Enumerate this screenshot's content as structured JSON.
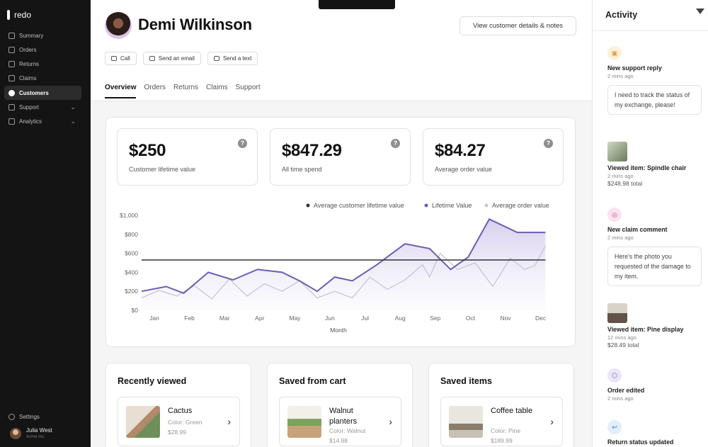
{
  "sidebar": {
    "logo": "redo",
    "nav": [
      {
        "label": "Summary",
        "active": false,
        "icon": "home-icon",
        "has_chevron": false
      },
      {
        "label": "Orders",
        "active": false,
        "icon": "box-icon",
        "has_chevron": false
      },
      {
        "label": "Returns",
        "active": false,
        "icon": "return-icon",
        "has_chevron": false
      },
      {
        "label": "Claims",
        "active": false,
        "icon": "alert-icon",
        "has_chevron": false
      },
      {
        "label": "Customers",
        "active": true,
        "icon": "customer-icon",
        "has_chevron": false
      },
      {
        "label": "Support",
        "active": false,
        "icon": "chat-icon",
        "has_chevron": true
      },
      {
        "label": "Analytics",
        "active": false,
        "icon": "chart-icon",
        "has_chevron": true
      }
    ],
    "settings_label": "Settings",
    "user": {
      "name": "Julia West",
      "org": "Acme Inc."
    }
  },
  "customer": {
    "name": "Demi Wilkinson",
    "details_button": "View customer details & notes",
    "actions": [
      "Call",
      "Send an email",
      "Send a text"
    ],
    "tabs": [
      "Overview",
      "Orders",
      "Returns",
      "Claims",
      "Support"
    ],
    "active_tab": "Overview"
  },
  "stats": [
    {
      "value": "$250",
      "label": "Customer lifetime value"
    },
    {
      "value": "$847.29",
      "label": "All time spend"
    },
    {
      "value": "$84.27",
      "label": "Average order value"
    }
  ],
  "chart_data": {
    "type": "line",
    "xlabel": "Month",
    "ylabel": "",
    "categories": [
      "Jan",
      "Feb",
      "Mar",
      "Apr",
      "May",
      "Jun",
      "Jul",
      "Aug",
      "Sep",
      "Oct",
      "Nov",
      "Dec"
    ],
    "y_ticks": [
      "$0",
      "$200",
      "$400",
      "$600",
      "$800",
      "$1,000"
    ],
    "ylim": [
      0,
      1000
    ],
    "legend": [
      "Average customer lifetime value",
      "Lifetime Value",
      "Average order value"
    ],
    "legend_placement": "top-right",
    "colors": {
      "average_clv": "#333333",
      "lifetime": "#6e5cb4",
      "order": "#c8c4d8"
    },
    "series": [
      {
        "name": "Average customer lifetime value",
        "x": [
          0,
          11.5
        ],
        "values": [
          530,
          530
        ]
      },
      {
        "name": "Lifetime Value",
        "x": [
          0,
          0.7,
          1.2,
          1.9,
          2.6,
          3.3,
          4.0,
          4.5,
          5.0,
          5.5,
          6.0,
          6.7,
          7.5,
          8.2,
          8.8,
          9.3,
          9.9,
          10.7,
          11.5
        ],
        "values": [
          200,
          250,
          180,
          400,
          320,
          430,
          400,
          310,
          200,
          350,
          310,
          480,
          700,
          650,
          430,
          560,
          960,
          820,
          820
        ]
      },
      {
        "name": "Average order value",
        "x": [
          0,
          0.5,
          1.0,
          1.5,
          2.0,
          2.5,
          3.0,
          3.5,
          4.0,
          4.5,
          5.0,
          5.5,
          6.0,
          6.5,
          7.0,
          7.5,
          8.0,
          8.2,
          8.5,
          9.0,
          9.5,
          10.0,
          10.5,
          10.9,
          11.2,
          11.5
        ],
        "values": [
          130,
          210,
          150,
          260,
          120,
          330,
          150,
          280,
          200,
          310,
          130,
          200,
          130,
          350,
          220,
          320,
          480,
          350,
          600,
          430,
          500,
          250,
          550,
          430,
          470,
          680
        ]
      }
    ]
  },
  "cards": [
    {
      "title": "Recently viewed",
      "item": {
        "name": "Cactus",
        "sub": "Color: Green",
        "price": "$28.99"
      }
    },
    {
      "title": "Saved from cart",
      "item": {
        "name": "Walnut planters",
        "sub": "Color: Walnut",
        "price": "$14.98"
      }
    },
    {
      "title": "Saved items",
      "item": {
        "name": "Coffee table",
        "sub": "Color: Pine",
        "price": "$189.99"
      }
    }
  ],
  "activity": {
    "title": "Activity",
    "events": [
      {
        "title": "New support reply",
        "time": "2 mins ago",
        "bubble": "I need to track the status of my exchange, please!"
      },
      {
        "title": "Viewed item: Spindle chair",
        "time": "2 mins ago",
        "extra": "$248.98 total"
      },
      {
        "title": "New claim comment",
        "time": "2 mins ago",
        "bubble": "Here's the photo you requested of the damage to my item."
      },
      {
        "title": "Viewed item: Pine display",
        "time": "12 mins ago",
        "extra": "$28.49 total"
      },
      {
        "title": "Order edited",
        "time": "2 mins ago"
      },
      {
        "title": "Return status updated",
        "time": ""
      }
    ]
  }
}
